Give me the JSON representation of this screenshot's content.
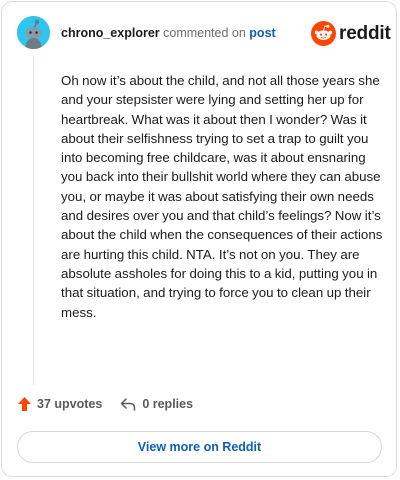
{
  "comment": {
    "username": "chrono_explorer",
    "action_text": "commented on",
    "target_link": "post",
    "body": "Oh now it’s about the child, and not all those years she and your stepsister were lying and setting her up for heartbreak. What was it about then I wonder? Was it about their selfishness trying to set a trap to guilt you into becoming free childcare, was it about ensnaring you back into their bullshit world where they can abuse you, or maybe it was about satisfying their own needs and desires over you and that child’s feelings? Now it’s about the child when the consequences of their actions are hurting this child. NTA. It’s not on you. They are absolute assholes for doing this to a kid, putting you in that situation, and trying to force you to clean up their mess."
  },
  "brand": {
    "wordmark": "reddit",
    "icon": "reddit-alien-icon",
    "color": "#ff4500"
  },
  "stats": {
    "upvotes": "37 upvotes",
    "upvote_icon": "upvote-arrow-icon",
    "replies": "0 replies",
    "reply_icon": "reply-arrow-icon"
  },
  "footer": {
    "view_more_label": "View more on Reddit"
  },
  "colors": {
    "avatar_bg": "#2fc5ee",
    "link": "#0f5fb8",
    "upvote": "#ff4500",
    "text": "#1c1c1c",
    "muted": "#6e6e6e"
  }
}
